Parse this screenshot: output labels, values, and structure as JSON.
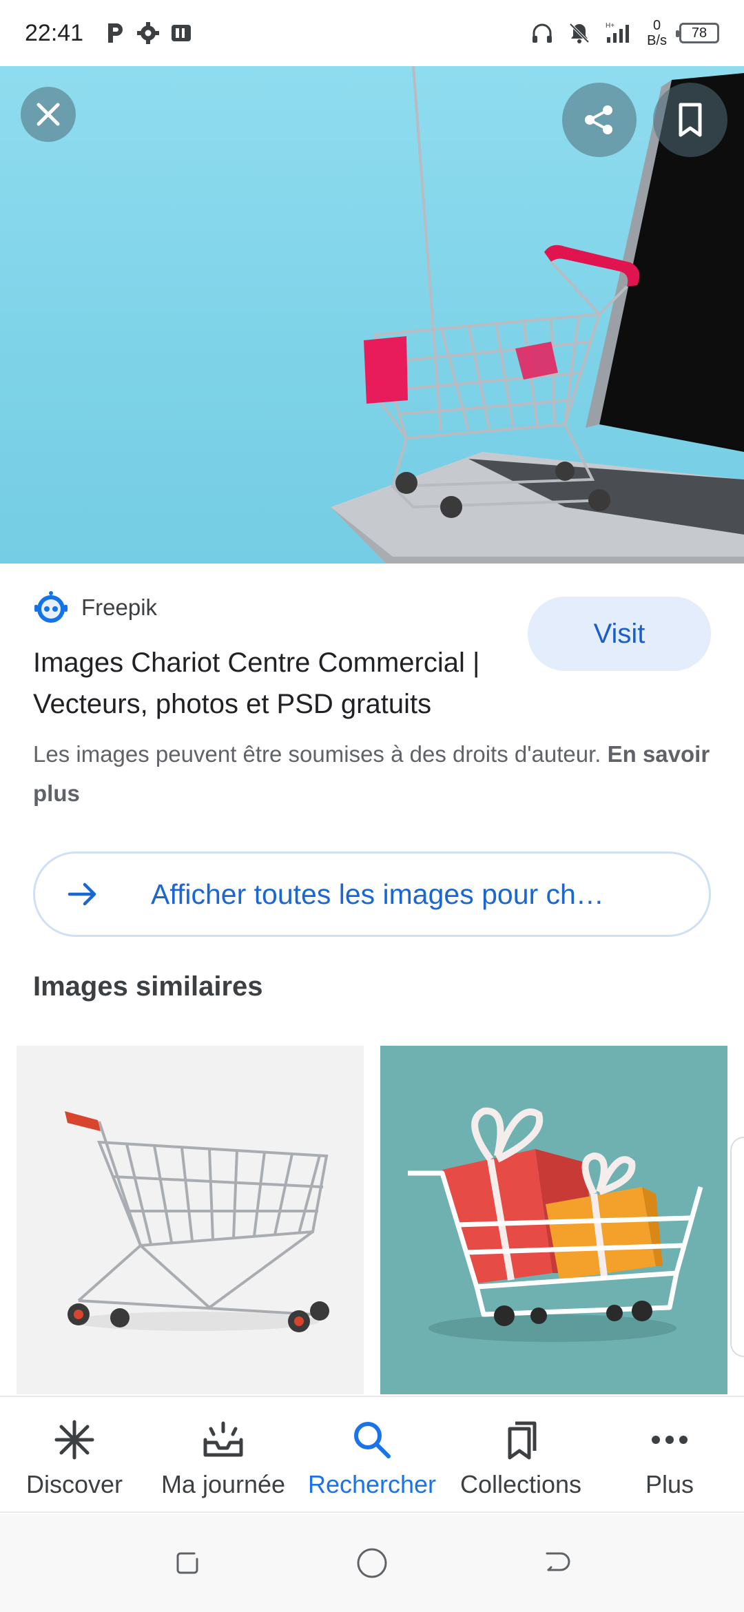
{
  "status_bar": {
    "time": "22:41",
    "net_speed_value": "0",
    "net_speed_unit": "B/s",
    "battery": "78"
  },
  "result": {
    "source_name": "Freepik",
    "visit_label": "Visit",
    "title": "Images Chariot Centre Commercial | Vecteurs, photos et PSD gratuits",
    "copyright_text": "Les images peuvent être soumises à des droits d'auteur.",
    "learn_more": "En savoir plus",
    "see_all_label": "Afficher toutes les images pour ch…"
  },
  "similar": {
    "title": "Images similaires"
  },
  "bottom_nav": {
    "items": [
      {
        "label": "Discover",
        "icon": "discover-icon"
      },
      {
        "label": "Ma journée",
        "icon": "inbox-icon"
      },
      {
        "label": "Rechercher",
        "icon": "search-icon"
      },
      {
        "label": "Collections",
        "icon": "collections-icon"
      },
      {
        "label": "Plus",
        "icon": "more-icon"
      }
    ],
    "active_index": 2
  },
  "colors": {
    "accent": "#1a73e8",
    "visit_bg": "#e3edfb",
    "hero_bg": "#86d7eb"
  }
}
